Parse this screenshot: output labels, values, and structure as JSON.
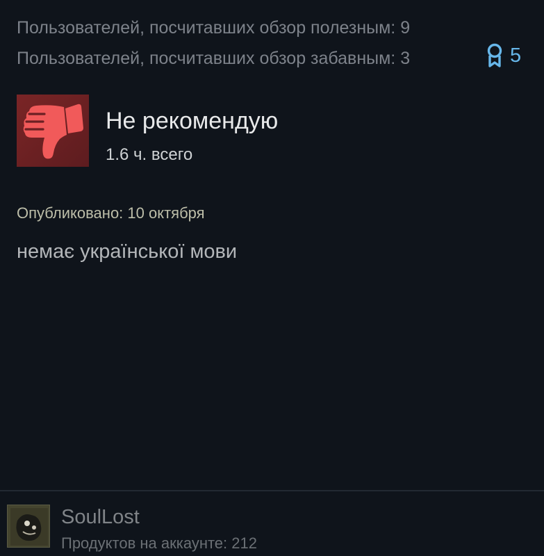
{
  "review": {
    "helpful_text": "Пользователей, посчитавших обзор полезным: 9",
    "funny_text": "Пользователей, посчитавших обзор забавным: 3",
    "awards_count": "5",
    "verdict": "Не рекомендую",
    "hours": "1.6 ч. всего",
    "posted": "Опубликовано: 10 октября",
    "text": "немає української мови"
  },
  "author": {
    "name": "SoulLost",
    "products": "Продуктов на аккаунте: 212"
  },
  "icons": {
    "award": "award-ribbon-icon",
    "verdict": "thumbs-down-icon"
  },
  "colors": {
    "background": "#0f141b",
    "award": "#67b7ea",
    "thumb": "#f15a5a",
    "thumb_box": "#6b2023"
  }
}
